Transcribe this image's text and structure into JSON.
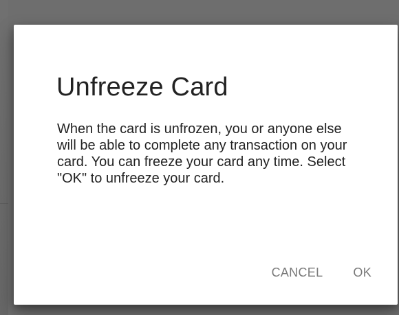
{
  "dialog": {
    "title": "Unfreeze Card",
    "message": "When the card is unfrozen, you or anyone else will be able to complete any transaction on your card. You can freeze your card any time. Select \"OK\" to unfreeze your card.",
    "buttons": {
      "cancel": "CANCEL",
      "ok": "OK"
    }
  },
  "colors": {
    "overlay": "#6e6e6e",
    "dialog_background": "#ffffff",
    "title_text": "#222222",
    "body_text": "#222222",
    "button_text": "#7a7a7a"
  }
}
